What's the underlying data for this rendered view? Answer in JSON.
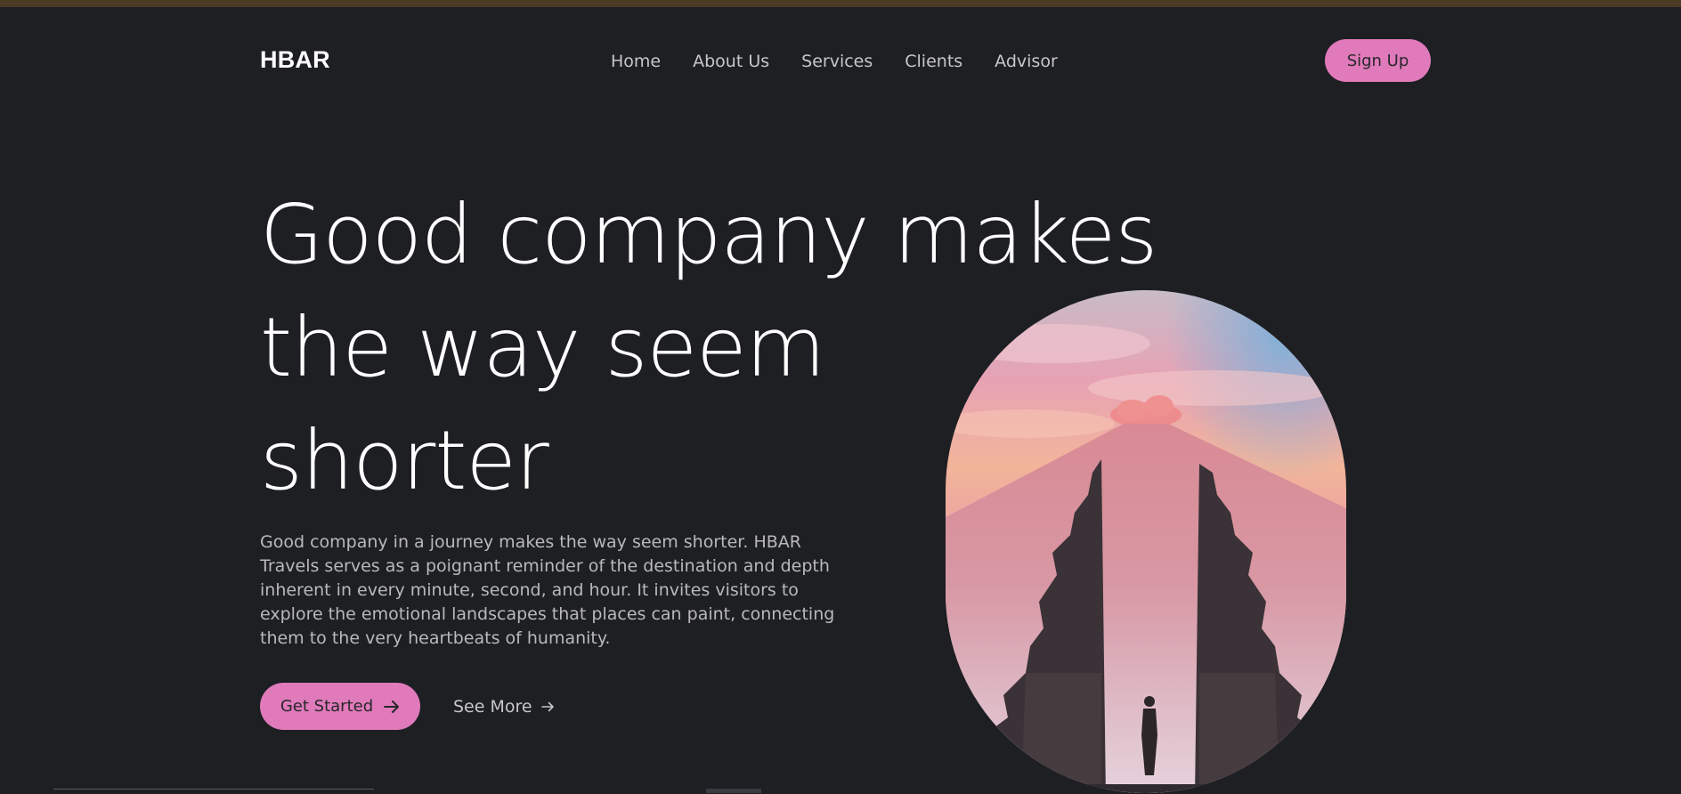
{
  "brand": {
    "logo_text": "HBAR"
  },
  "nav": {
    "links": [
      "Home",
      "About Us",
      "Services",
      "Clients",
      "Advisor"
    ],
    "signup_label": "Sign Up"
  },
  "hero": {
    "headline_lines": [
      "Good company makes",
      "the way seem",
      "shorter"
    ],
    "description": "Good company in a journey makes the way seem shorter. HBAR Travels serves as a poignant reminder of the destination and depth inherent in every minute, second, and hour. It invites visitors to explore the emotional landscapes that places can paint, connecting them to the very heartbeats of humanity.",
    "primary_cta": "Get Started",
    "secondary_cta": "See More",
    "image_icon": "temple-gate-photo"
  },
  "colors": {
    "background": "#1d1f23",
    "accent": "#e07aba",
    "top_strip": "#4a3a26",
    "text_primary": "#ffffff",
    "text_muted": "#b9b9bb"
  }
}
